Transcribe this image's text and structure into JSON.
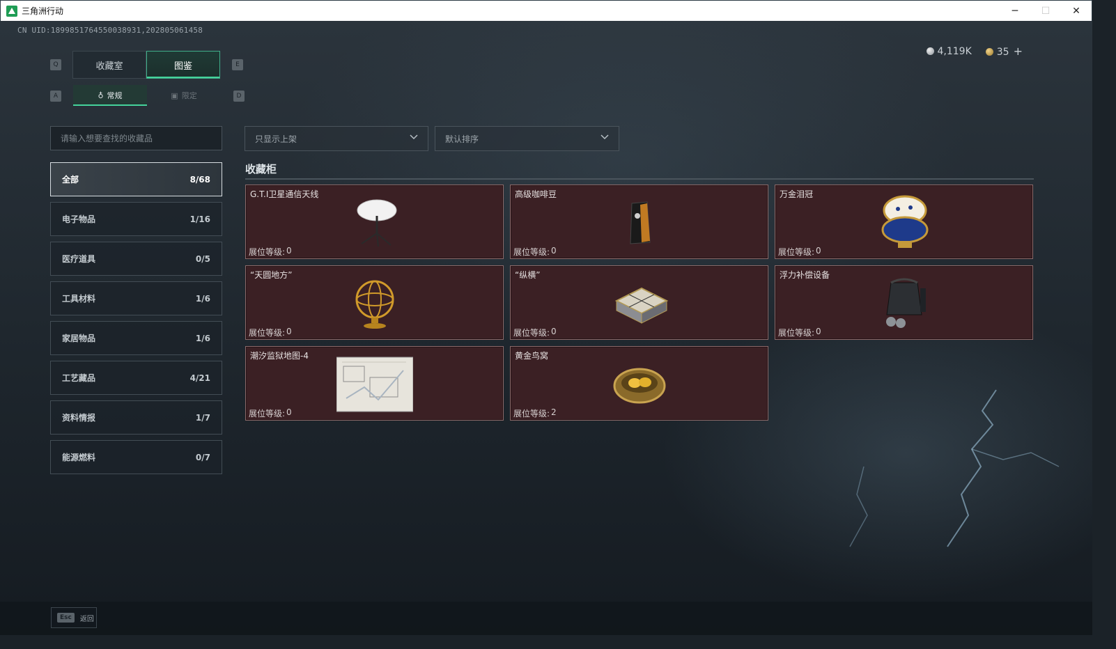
{
  "window": {
    "title": "三角洲行动",
    "minimize": "─",
    "maximize": "☐",
    "close": "✕"
  },
  "uid": "CN UID:1899851764550038931,202805061458",
  "keys": {
    "q": "Q",
    "e": "E",
    "a": "A",
    "d": "D",
    "esc": "Esc"
  },
  "tabs": [
    {
      "label": "收藏室"
    },
    {
      "label": "图鉴"
    }
  ],
  "subtabs": [
    {
      "label": "常规",
      "icon": "bottle-icon"
    },
    {
      "label": "限定",
      "icon": "frame-icon"
    }
  ],
  "currency": {
    "silver": "4,119K",
    "gold": "35",
    "plus": "+"
  },
  "search": {
    "placeholder": "请输入想要查找的收藏品"
  },
  "filters": {
    "shelf": "只显示上架",
    "sort": "默认排序"
  },
  "categories": [
    {
      "label": "全部",
      "count": "8/68"
    },
    {
      "label": "电子物品",
      "count": "1/16"
    },
    {
      "label": "医疗道具",
      "count": "0/5"
    },
    {
      "label": "工具材料",
      "count": "1/6"
    },
    {
      "label": "家居物品",
      "count": "1/6"
    },
    {
      "label": "工艺藏品",
      "count": "4/21"
    },
    {
      "label": "资料情报",
      "count": "1/7"
    },
    {
      "label": "能源燃料",
      "count": "0/7"
    }
  ],
  "section_title": "收藏柜",
  "level_label": "展位等级:",
  "items": [
    {
      "name": "G.T.I卫星通信天线",
      "level": "0",
      "icon": "satellite-dish-icon"
    },
    {
      "name": "高级咖啡豆",
      "level": "0",
      "icon": "coffee-bag-icon"
    },
    {
      "name": "万金泪冠",
      "level": "0",
      "icon": "jeweled-egg-icon"
    },
    {
      "name": "“天圆地方”",
      "level": "0",
      "icon": "armillary-sphere-icon"
    },
    {
      "name": "“纵横”",
      "level": "0",
      "icon": "chess-box-icon"
    },
    {
      "name": "浮力补偿设备",
      "level": "0",
      "icon": "bcd-vest-icon"
    },
    {
      "name": "潮汐监狱地图-4",
      "level": "0",
      "icon": "map-icon"
    },
    {
      "name": "黄金鸟窝",
      "level": "2",
      "icon": "golden-nest-icon"
    }
  ],
  "footer": {
    "back": "返回"
  }
}
